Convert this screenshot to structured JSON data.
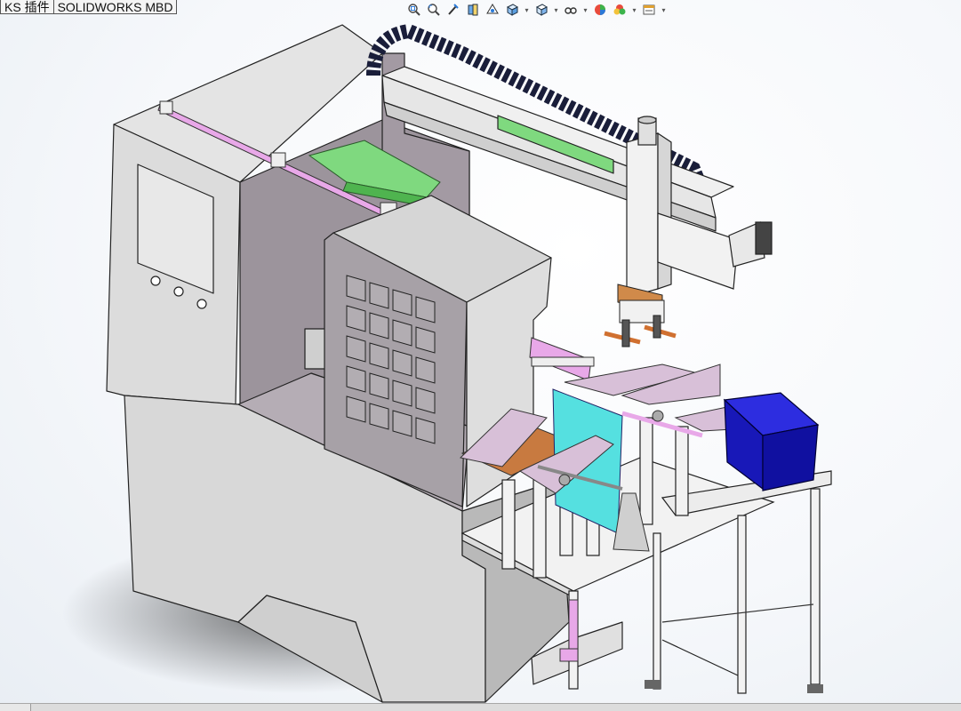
{
  "tabs": [
    {
      "label": "KS 插件"
    },
    {
      "label": "SOLIDWORKS MBD"
    }
  ],
  "heads_up_toolbar": {
    "buttons": [
      {
        "icon": "zoom-to-fit-icon",
        "dropdown": false
      },
      {
        "icon": "zoom-to-area-icon",
        "dropdown": false
      },
      {
        "icon": "previous-view-icon",
        "dropdown": false
      },
      {
        "icon": "section-view-icon",
        "dropdown": false
      },
      {
        "icon": "dynamic-annotation-views-icon",
        "dropdown": false
      },
      {
        "icon": "view-orientation-icon",
        "dropdown": true
      },
      {
        "icon": "display-style-icon",
        "dropdown": true
      },
      {
        "icon": "hide-show-items-icon",
        "dropdown": true
      },
      {
        "icon": "edit-appearance-icon",
        "dropdown": false
      },
      {
        "icon": "apply-scene-icon",
        "dropdown": true
      },
      {
        "icon": "view-settings-icon",
        "dropdown": true
      }
    ]
  },
  "model": {
    "description_shown": false,
    "colors": {
      "machine_body": "#d9d9d9",
      "machine_shadow": "#c2c2c2",
      "cover_dark": "#9d9d9d",
      "pink_parts": "#e8a8e8",
      "rail_green": "#6fd66f",
      "glass_cyan": "#55e0e0",
      "bin_blue": "#1a1ad0",
      "accent_orange": "#d07030",
      "cable_chain": "#1a1e3a",
      "frame_white": "#f2f2f2"
    }
  }
}
